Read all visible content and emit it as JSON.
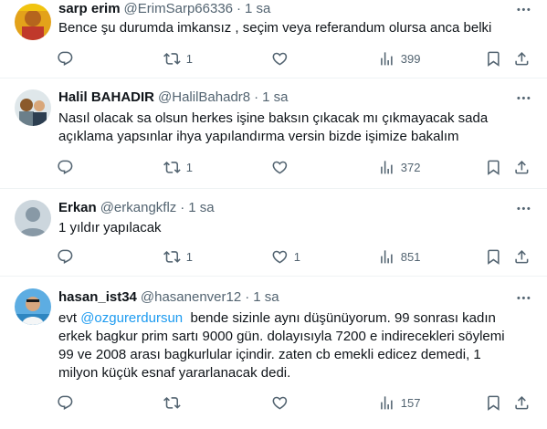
{
  "tweets": [
    {
      "name": "sarp erim",
      "handle": "@ErimSarp66336",
      "dot": "·",
      "time": "1 sa",
      "text": "Bence şu durumda imkansız , seçim veya referandum olursa anca belki",
      "replies": "",
      "retweets": "1",
      "likes": "",
      "views": "399"
    },
    {
      "name": "Halil BAHADIR",
      "handle": "@HalilBahadr8",
      "dot": "·",
      "time": "1 sa",
      "text_line1": "Nasıl olacak sa olsun herkes işine baksın çıkacak mı çıkmayacak sada",
      "text_line2": "açıklama yapsınlar ihya yapılandırma versin bizde işimize bakalım",
      "replies": "",
      "retweets": "1",
      "likes": "",
      "views": "372"
    },
    {
      "name": "Erkan",
      "handle": "@erkangkflz",
      "dot": "·",
      "time": "1 sa",
      "text": "1 yıldır yapılacak",
      "replies": "",
      "retweets": "1",
      "likes": "1",
      "views": "851"
    },
    {
      "name": "hasan_ist34",
      "handle": "@hasanenver12",
      "dot": "·",
      "time": "1 sa",
      "mention": "@ozgurerdursun",
      "text_line1_rest": "  bende sizinle aynı düşünüyorum. 99 sonrası kadın",
      "text_line1_prefix": "evt ",
      "text_line2": "erkek bagkur prim sartı 9000 gün. dolayısıyla 7200 e indirecekleri söylemi",
      "text_line3": "99 ve 2008 arası bagkurlular içindir. zaten cb emekli edicez demedi, 1",
      "text_line4": "milyon küçük esnaf yararlanacak dedi.",
      "replies": "",
      "retweets": "",
      "likes": "",
      "views": "157"
    }
  ],
  "icons": {
    "reply": "reply-icon",
    "retweet": "retweet-icon",
    "like": "heart-icon",
    "views": "views-icon",
    "bookmark": "bookmark-icon",
    "share": "share-icon",
    "more": "more-icon"
  },
  "colors": {
    "text": "#0f1419",
    "secondary": "#536471",
    "link": "#1d9bf0",
    "divider": "#eff3f4"
  }
}
